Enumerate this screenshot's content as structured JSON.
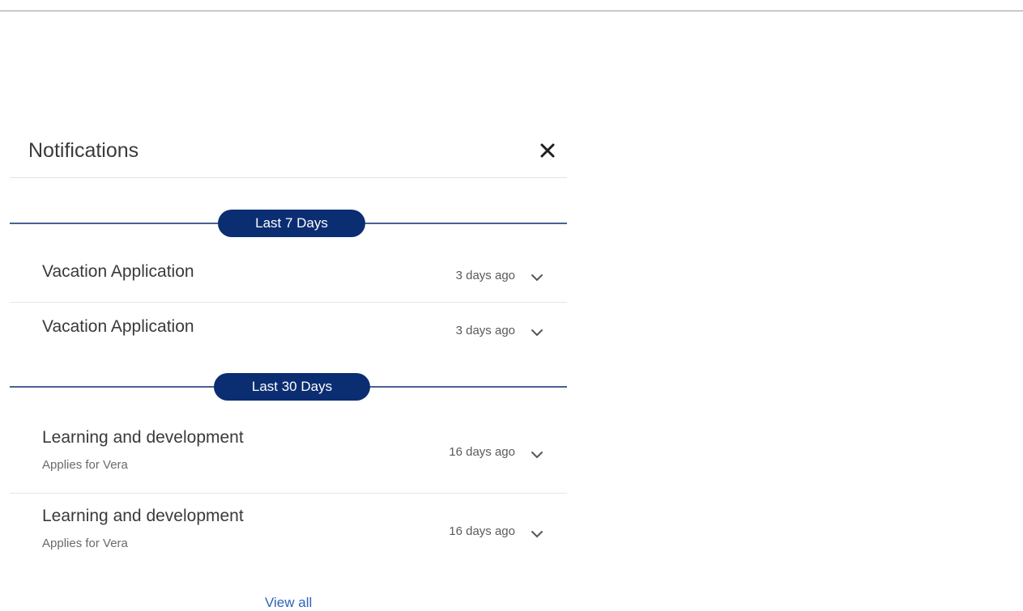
{
  "panel": {
    "title": "Notifications",
    "close_icon": "close-icon"
  },
  "groups": [
    {
      "label": "Last 7 Days",
      "items": [
        {
          "title": "Vacation Application",
          "subtitle": "",
          "time": "3 days ago"
        },
        {
          "title": "Vacation Application",
          "subtitle": "",
          "time": "3 days ago"
        }
      ]
    },
    {
      "label": "Last 30 Days",
      "items": [
        {
          "title": "Learning and development",
          "subtitle": "Applies for Vera",
          "time": "16 days ago"
        },
        {
          "title": "Learning and development",
          "subtitle": "Applies for Vera",
          "time": "16 days ago"
        }
      ]
    }
  ],
  "footer": {
    "view_all_label": "View all"
  },
  "colors": {
    "pill_background": "#0b2d72",
    "divider_line": "#4b5f95",
    "link": "#2f63b8"
  }
}
